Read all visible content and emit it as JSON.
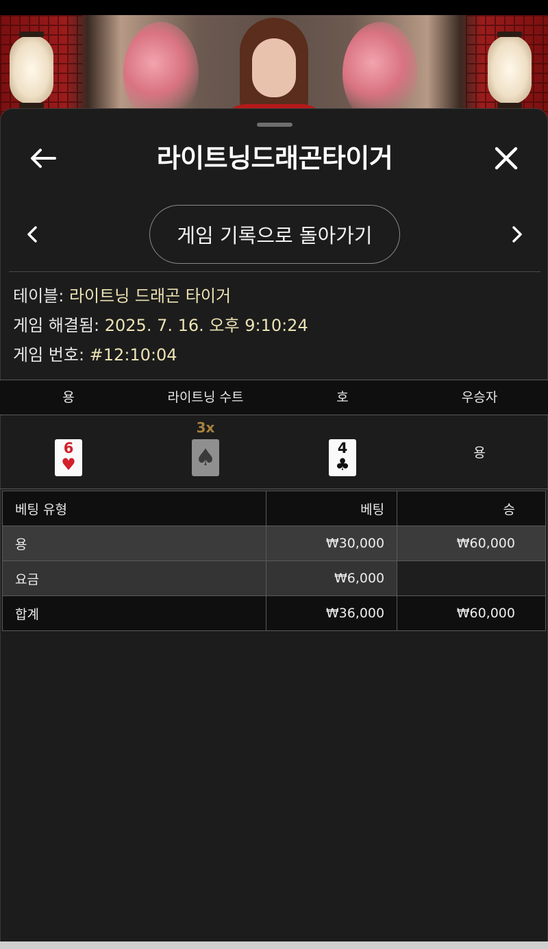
{
  "header": {
    "title": "라이트닝드래곤타이거"
  },
  "nav": {
    "back_to_history": "게임 기록으로 돌아가기"
  },
  "info": {
    "table_label": "테이블: ",
    "table_value": "라이트닝 드래곤 타이거",
    "resolved_label": "게임 해결됨: ",
    "resolved_value": "2025. 7. 16. 오후 9:10:24",
    "game_no_label": "게임 번호: ",
    "game_no_value": "#12:10:04"
  },
  "result": {
    "headers": [
      "용",
      "라이트닝 수트",
      "호",
      "우승자"
    ],
    "dragon_card": {
      "rank": "6",
      "suit": "♥",
      "color": "#d21f2b"
    },
    "lightning_suit": {
      "multiplier": "3x",
      "suit": "♠"
    },
    "tiger_card": {
      "rank": "4",
      "suit": "♣",
      "color": "#111111"
    },
    "winner": "용"
  },
  "bets": {
    "headers": {
      "type": "베팅 유형",
      "bet": "베팅",
      "win": "승"
    },
    "rows": [
      {
        "type": "용",
        "bet": "₩30,000",
        "win": "₩60,000"
      },
      {
        "type": "요금",
        "bet": "₩6,000",
        "win": ""
      },
      {
        "type": "합계",
        "bet": "₩36,000",
        "win": "₩60,000"
      }
    ]
  },
  "icons": {
    "back": "arrow-left-icon",
    "close": "close-icon",
    "prev": "chevron-left-icon",
    "next": "chevron-right-icon"
  },
  "colors": {
    "sheet_bg": "#1c1c1c",
    "value_text": "#ece2b4",
    "multiplier": "#a7823d"
  }
}
